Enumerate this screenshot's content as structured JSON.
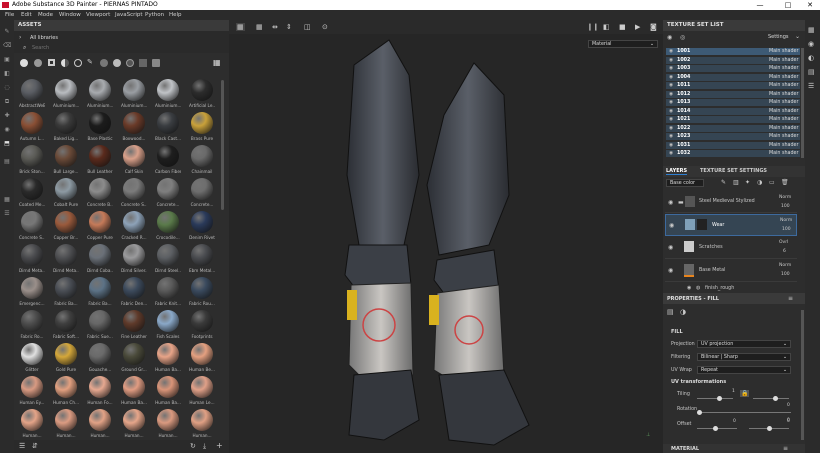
{
  "titlebar": {
    "title": "Adobe Substance 3D Painter - PIERNAS PINTADO",
    "minimize": "—",
    "maximize": "□",
    "close": "✕"
  },
  "menu": [
    "File",
    "Edit",
    "Mode",
    "Window",
    "Viewport",
    "JavaScript",
    "Python",
    "Help"
  ],
  "assets": {
    "title": "ASSETS",
    "library": "All libraries",
    "search_placeholder": "Search",
    "items": [
      "AbstractWeB...",
      "Aluminium...",
      "Aluminium...",
      "Aluminium...",
      "Aluminium...",
      "Artificial Le...",
      "Autumn L...",
      "Baked Lig...",
      "Base Plastic",
      "Boxwood...",
      "Black Cast...",
      "Brass Pure",
      "Brick Ston...",
      "Bull Large...",
      "Bull Leather",
      "Calf Skin",
      "Carbon Fiber",
      "Chainmail",
      "Coated Me...",
      "Cobalt Pure",
      "Concrete B...",
      "Concrete S...",
      "Concrete...",
      "Concrete...",
      "Concrete S...",
      "Copper Br...",
      "Copper Pure",
      "Cracked R...",
      "Crocodile...",
      "Denim Rivet",
      "Dirnd Meta...",
      "Dirnd Meta...",
      "Dirnd Coba...",
      "Dirnd Silver...",
      "Dirnd Steel...",
      "Ebm Metal...",
      "Emergenc...",
      "Fabric Ba...",
      "Fabric Ba...",
      "Fabric Den...",
      "Fabric Knit...",
      "Fabric Rou...",
      "Fabric Ro...",
      "Fabric Soft...",
      "Fabric Sue...",
      "Fine Leather",
      "Fish Scales",
      "Footprints",
      "Glitter",
      "Gold Pure",
      "Gouache...",
      "Ground Gr...",
      "Human Ba...",
      "Human Be...",
      "Human Ey...",
      "Human Ch...",
      "Human Fo...",
      "Human Ba...",
      "Human Ba...",
      "Human Le...",
      "Human...",
      "Human...",
      "Human...",
      "Human...",
      "Human...",
      "Human..."
    ]
  },
  "viewport": {
    "material_dropdown": "Material"
  },
  "texture_set_list": {
    "title": "TEXTURE SET LIST",
    "settings": "Settings",
    "rows": [
      {
        "name": "1001",
        "shader": "Main shader"
      },
      {
        "name": "1002",
        "shader": "Main shader"
      },
      {
        "name": "1003",
        "shader": "Main shader"
      },
      {
        "name": "1004",
        "shader": "Main shader"
      },
      {
        "name": "1011",
        "shader": "Main shader"
      },
      {
        "name": "1012",
        "shader": "Main shader"
      },
      {
        "name": "1013",
        "shader": "Main shader"
      },
      {
        "name": "1014",
        "shader": "Main shader"
      },
      {
        "name": "1021",
        "shader": "Main shader"
      },
      {
        "name": "1022",
        "shader": "Main shader"
      },
      {
        "name": "1023",
        "shader": "Main shader"
      },
      {
        "name": "1031",
        "shader": "Main shader"
      },
      {
        "name": "1032",
        "shader": "Main shader"
      }
    ]
  },
  "layers": {
    "tab_layers": "LAYERS",
    "tab_settings": "TEXTURE SET SETTINGS",
    "channel": "Base color",
    "items": [
      {
        "name": "Steel Medieval Stylized",
        "blend": "Norm",
        "opacity": "100"
      },
      {
        "name": "Wear",
        "blend": "Norm",
        "opacity": "100"
      },
      {
        "name": "Scratches",
        "blend": "Ovrl",
        "opacity": "6"
      },
      {
        "name": "Base Metal",
        "blend": "Norm",
        "opacity": "100"
      },
      {
        "name": "finish_rough",
        "blend": "",
        "opacity": ""
      }
    ]
  },
  "properties": {
    "title": "PROPERTIES - FILL",
    "fill_label": "FILL",
    "projection_label": "Projection",
    "projection_value": "UV projection",
    "filtering_label": "Filtering",
    "filtering_value": "Bilinear | Sharp",
    "uvwrap_label": "UV Wrap",
    "uvwrap_value": "Repeat",
    "uvtrans_label": "UV transformations",
    "tiling_label": "Tiling",
    "tiling_value": "1",
    "tiling_value2": "0",
    "rotation_label": "Rotation",
    "rotation_value": "0",
    "offset_label": "Offset",
    "offset_value": "0",
    "offset_value2": "0",
    "material_label": "MATERIAL"
  },
  "colors": {
    "accent": "#e8841c",
    "selection": "#354553",
    "ts_highlight": "#3d5a75"
  }
}
